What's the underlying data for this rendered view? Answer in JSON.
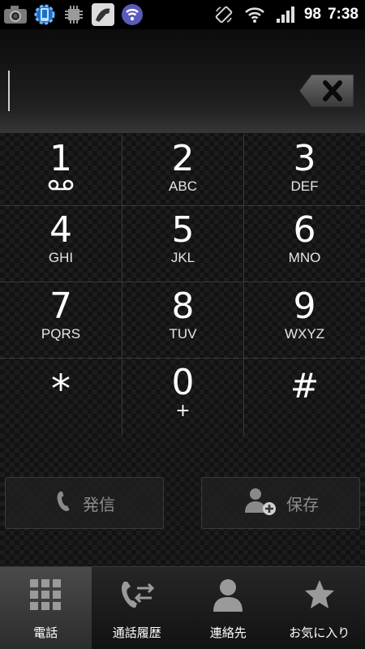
{
  "status_bar": {
    "notification_icons": [
      "camera-icon",
      "settings-gear-icon",
      "chip-icon",
      "app-icon",
      "wifi-app-icon"
    ],
    "rotate_icon": "screen-rotation-icon",
    "wifi_icon": "wifi-icon",
    "signal_icon": "signal-bars-icon",
    "battery_level": "98",
    "time": "7:38"
  },
  "display": {
    "number_value": "",
    "backspace_icon": "backspace-icon"
  },
  "keypad": {
    "keys": [
      {
        "digit": "1",
        "sub": "",
        "icon": "voicemail-icon"
      },
      {
        "digit": "2",
        "sub": "ABC"
      },
      {
        "digit": "3",
        "sub": "DEF"
      },
      {
        "digit": "4",
        "sub": "GHI"
      },
      {
        "digit": "5",
        "sub": "JKL"
      },
      {
        "digit": "6",
        "sub": "MNO"
      },
      {
        "digit": "7",
        "sub": "PQRS"
      },
      {
        "digit": "8",
        "sub": "TUV"
      },
      {
        "digit": "9",
        "sub": "WXYZ"
      },
      {
        "digit": "*",
        "sub": ""
      },
      {
        "digit": "0",
        "sub": "+"
      },
      {
        "digit": "#",
        "sub": ""
      }
    ]
  },
  "actions": {
    "call_label": "発信",
    "call_icon": "phone-handset-icon",
    "save_label": "保存",
    "save_icon": "add-contact-icon"
  },
  "tabs": [
    {
      "label": "電話",
      "icon": "dialpad-grid-icon",
      "active": true
    },
    {
      "label": "通話履歴",
      "icon": "call-log-icon",
      "active": false
    },
    {
      "label": "連絡先",
      "icon": "contact-person-icon",
      "active": false
    },
    {
      "label": "お気に入り",
      "icon": "star-icon",
      "active": false
    }
  ],
  "colors": {
    "text": "#ffffff",
    "button_text": "#8c8c8c",
    "background": "#121212"
  }
}
